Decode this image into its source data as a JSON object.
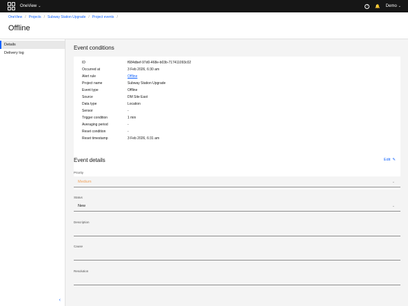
{
  "app": {
    "title": "OneView"
  },
  "topbar": {
    "user": "Demo"
  },
  "breadcrumb": [
    "OneView",
    "Projects",
    "Subway Station Upgrade",
    "Project events"
  ],
  "page": {
    "title": "Offline"
  },
  "sidebar": {
    "items": [
      {
        "label": "Details"
      },
      {
        "label": "Delivery log"
      }
    ]
  },
  "event_conditions": {
    "title": "Event conditions",
    "rows": [
      {
        "key": "ID",
        "value": "f684dbef-97d0-468e-b03b-717411093c02"
      },
      {
        "key": "Occurred at",
        "value": "3 Feb 2026, 6:30 am"
      },
      {
        "key": "Alert rule",
        "value": "Offline"
      },
      {
        "key": "Project name",
        "value": "Subway Station Upgrade"
      },
      {
        "key": "Event type",
        "value": "Offline"
      },
      {
        "key": "Source",
        "value": "DM Site East"
      },
      {
        "key": "Data type",
        "value": "Location"
      },
      {
        "key": "Sensor",
        "value": "-"
      },
      {
        "key": "Trigger condition",
        "value": "1 min"
      },
      {
        "key": "Averaging period",
        "value": "-"
      },
      {
        "key": "Reset condition",
        "value": "-"
      },
      {
        "key": "Reset timestamp",
        "value": "3 Feb 2026, 6:31 am"
      }
    ]
  },
  "event_details": {
    "title": "Event details",
    "edit_label": "Edit",
    "priority_label": "Priority",
    "priority_value": "Medium",
    "status_label": "Status",
    "status_value": "New",
    "description_label": "Description",
    "description_value": "",
    "cause_label": "Cause",
    "cause_value": "",
    "resolution_label": "Resolution",
    "resolution_value": ""
  },
  "colors": {
    "accent": "#0f62fe",
    "priority_medium": "#f1a25a",
    "topbar": "#161616"
  }
}
